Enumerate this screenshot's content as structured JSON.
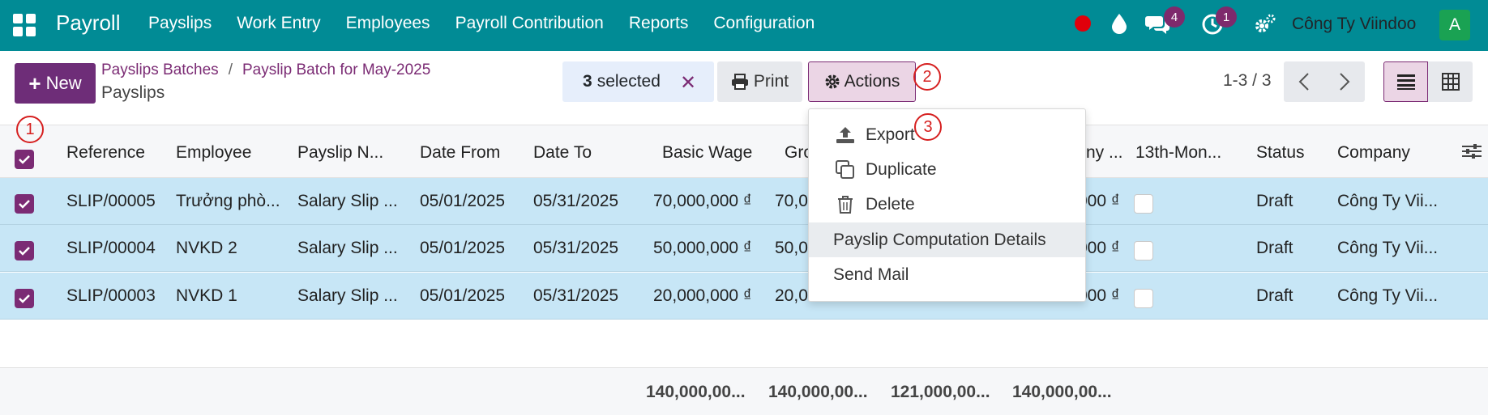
{
  "navbar": {
    "app_name": "Payroll",
    "menu": [
      "Payslips",
      "Work Entry",
      "Employees",
      "Payroll Contribution",
      "Reports",
      "Configuration"
    ],
    "messages_badge": "4",
    "activities_badge": "1",
    "company": "Công Ty Viindoo",
    "avatar_letter": "A",
    "bg_color": "#018b95"
  },
  "control": {
    "new_label": "New",
    "breadcrumb": [
      "Payslips Batches",
      "Payslip Batch for May-2025"
    ],
    "breadcrumb_sep": "/",
    "title": "Payslips",
    "selected_count": "3",
    "selected_text": "selected",
    "print_label": "Print",
    "actions_label": "Actions",
    "pager": "1-3 / 3",
    "accent": "#7b2b74"
  },
  "markers": [
    "1",
    "2",
    "3"
  ],
  "table": {
    "columns": [
      "Reference",
      "Employee",
      "Payslip N...",
      "Date From",
      "Date To",
      "Basic Wage",
      "Gro",
      "ny ...",
      "13th-Mon...",
      "Status",
      "Company"
    ],
    "rows": [
      {
        "ref": "SLIP/00005",
        "employee": "Trưởng phò...",
        "name": "Salary Slip ...",
        "date_from": "05/01/2025",
        "date_to": "05/31/2025",
        "basic": "70,000,000 ₫",
        "gross": "70,0",
        "net": "000 ₫",
        "status": "Draft",
        "company": "Công Ty Vii..."
      },
      {
        "ref": "SLIP/00004",
        "employee": "NVKD 2",
        "name": "Salary Slip ...",
        "date_from": "05/01/2025",
        "date_to": "05/31/2025",
        "basic": "50,000,000 ₫",
        "gross": "50,0",
        "net": "000 ₫",
        "status": "Draft",
        "company": "Công Ty Vii..."
      },
      {
        "ref": "SLIP/00003",
        "employee": "NVKD 1",
        "name": "Salary Slip ...",
        "date_from": "05/01/2025",
        "date_to": "05/31/2025",
        "basic": "20,000,000 ₫",
        "gross": "20,0",
        "net": "000 ₫",
        "status": "Draft",
        "company": "Công Ty Vii..."
      }
    ],
    "totals": [
      "140,000,00...",
      "140,000,00...",
      "121,000,00...",
      "140,000,00..."
    ],
    "row_color": "#c7e6f6"
  },
  "dropdown": {
    "items": [
      "Export",
      "Duplicate",
      "Delete",
      "Payslip Computation Details",
      "Send Mail"
    ]
  }
}
